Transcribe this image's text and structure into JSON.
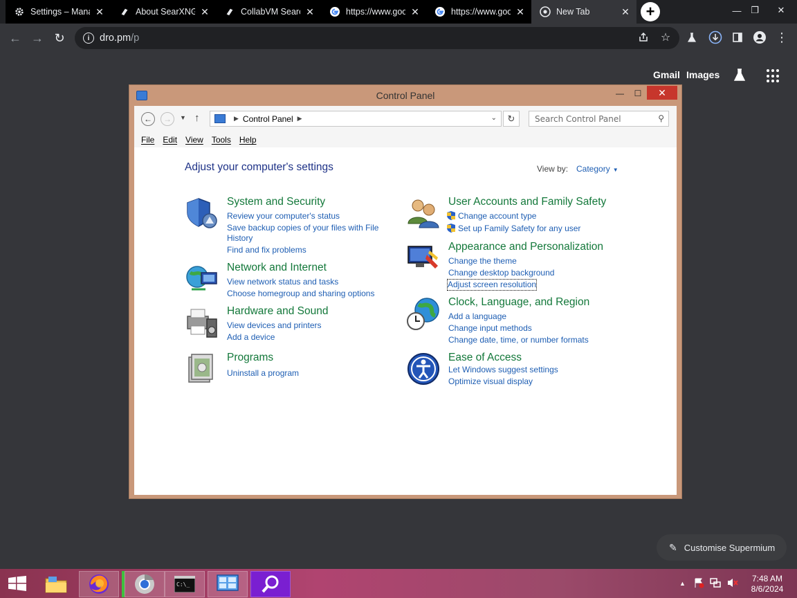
{
  "browser": {
    "tabs": [
      {
        "title": "Settings – Manage",
        "icon": "gear-icon"
      },
      {
        "title": "About SearXNG",
        "icon": "searxng-icon"
      },
      {
        "title": "CollabVM Search",
        "icon": "searxng-icon"
      },
      {
        "title": "https://www.google.com",
        "icon": "google-icon"
      },
      {
        "title": "https://www.google.com",
        "icon": "google-icon"
      },
      {
        "title": "New Tab",
        "icon": "chrome-icon",
        "active": true
      }
    ],
    "url_host": "dro.pm",
    "url_path": "/p"
  },
  "ntp": {
    "gmail": "Gmail",
    "images": "Images",
    "customise": "Customise Supermium"
  },
  "control_panel": {
    "window_title": "Control Panel",
    "address": "Control Panel",
    "search_placeholder": "Search Control Panel",
    "menus": [
      "File",
      "Edit",
      "View",
      "Tools",
      "Help"
    ],
    "heading": "Adjust your computer's settings",
    "view_by_label": "View by:",
    "view_by_value": "Category",
    "categories": [
      {
        "title": "System and Security",
        "links": [
          "Review your computer's status",
          "Save backup copies of your files with File",
          "History",
          "Find and fix problems"
        ]
      },
      {
        "title": "Network and Internet",
        "links": [
          "View network status and tasks",
          "Choose homegroup and sharing options"
        ]
      },
      {
        "title": "Hardware and Sound",
        "links": [
          "View devices and printers",
          "Add a device"
        ]
      },
      {
        "title": "Programs",
        "links": [
          "Uninstall a program"
        ]
      },
      {
        "title": "User Accounts and Family Safety",
        "links": [
          "Change account type",
          "Set up Family Safety for any user"
        ]
      },
      {
        "title": "Appearance and Personalization",
        "links": [
          "Change the theme",
          "Change desktop background",
          "Adjust screen resolution"
        ]
      },
      {
        "title": "Clock, Language, and Region",
        "links": [
          "Add a language",
          "Change input methods",
          "Change date, time, or number formats"
        ]
      },
      {
        "title": "Ease of Access",
        "links": [
          "Let Windows suggest settings",
          "Optimize visual display"
        ]
      }
    ]
  },
  "taskbar": {
    "time": "7:48 AM",
    "date": "8/6/2024"
  },
  "colors": {
    "chrome_dark": "#202124",
    "chrome_toolbar": "#35363a",
    "cp_frame": "#c9987a",
    "cp_link": "#1e5eb3",
    "cp_category": "#13783a",
    "cp_heading": "#1e3287",
    "close_red": "#c7362c"
  }
}
